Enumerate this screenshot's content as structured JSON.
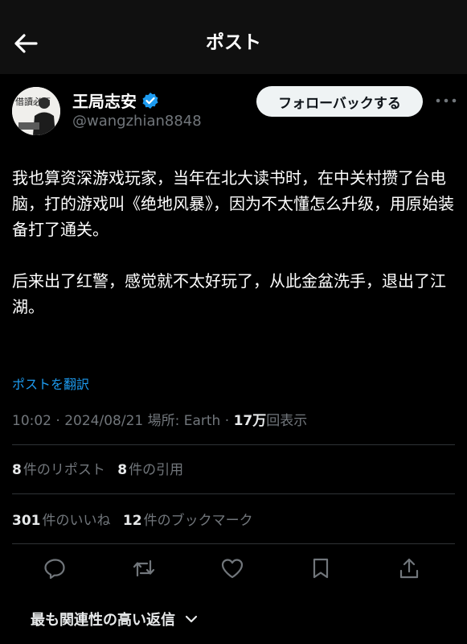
{
  "header": {
    "title": "ポスト",
    "back_icon": "arrow-left-icon"
  },
  "author": {
    "name": "王局志安",
    "handle": "@wangzhian8848",
    "verified_color": "#1d9bf0",
    "avatar_text": "借讀必西",
    "follow_label": "フォローバックする"
  },
  "post": {
    "paragraphs": [
      "我也算资深游戏玩家，当年在北大读书时，在中关村攒了台电脑，打的游戏叫《绝地风暴》，因为不太懂怎么升级，用原始装备打了通关。",
      "后来出了红警，感觉就不太好玩了，从此金盆洗手，退出了江湖。"
    ],
    "translate_label": "ポストを翻訳"
  },
  "meta": {
    "time": "10:02",
    "date": "2024/08/21",
    "location_label": "場所: Earth",
    "views_count": "17万",
    "views_label": "回表示"
  },
  "stats": {
    "reposts_count": "8",
    "reposts_label": "件のリポスト",
    "quotes_count": "8",
    "quotes_label": "件の引用",
    "likes_count": "301",
    "likes_label": "件のいいね",
    "bookmarks_count": "12",
    "bookmarks_label": "件のブックマーク"
  },
  "actions": [
    "reply-icon",
    "repost-icon",
    "like-icon",
    "bookmark-icon",
    "share-icon"
  ],
  "replies": {
    "sort_label": "最も関連性の高い返信"
  },
  "colors": {
    "accent": "#1d9bf0",
    "background": "#000000",
    "muted": "#71767b"
  }
}
